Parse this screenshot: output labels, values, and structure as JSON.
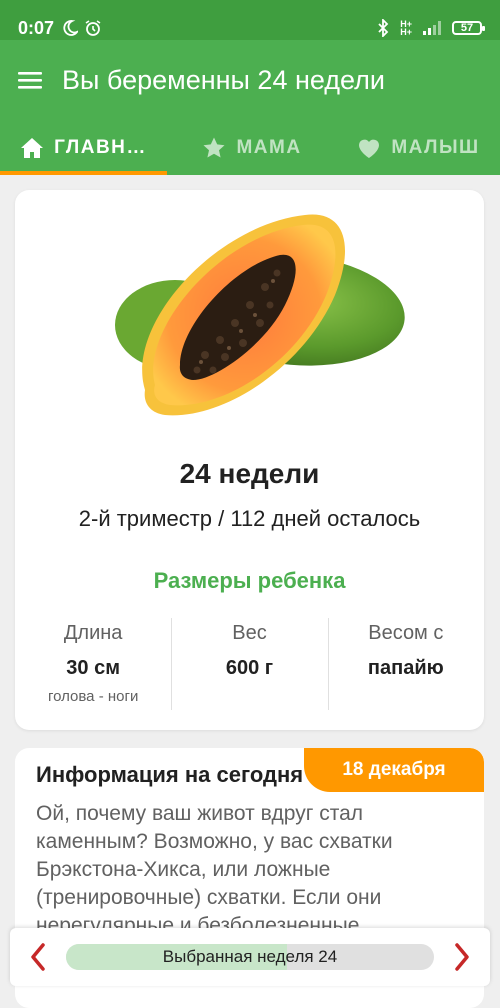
{
  "status_bar": {
    "time": "0:07",
    "battery": "57",
    "network_top": "H+",
    "network_bottom": "H+"
  },
  "app_bar": {
    "title": "Вы беременны 24 недели"
  },
  "tabs": [
    {
      "label": "ГЛАВН…",
      "icon": "home-icon",
      "active": true
    },
    {
      "label": "МАМА",
      "icon": "star-icon",
      "active": false
    },
    {
      "label": "МАЛЫШ",
      "icon": "heart-icon",
      "active": false
    }
  ],
  "week_card": {
    "image": "papaya-image",
    "week_title": "24 недели",
    "subtitle": "2-й триместр / 112 дней осталось",
    "sizes_title": "Размеры ребенка",
    "stats": [
      {
        "label": "Длина",
        "value": "30 см",
        "sub": "голова - ноги"
      },
      {
        "label": "Вес",
        "value": "600 г",
        "sub": ""
      },
      {
        "label": "Весом с",
        "value": "папайю",
        "sub": ""
      }
    ]
  },
  "info_card": {
    "title": "Информация на сегодня",
    "date": "18 декабря",
    "text": "Ой, почему ваш живот вдруг стал каменным? Возможно, у вас схватки Брэкстона-Хикса, или ложные (тренировочные) схватки. Если они нерегулярные и безболезненные,"
  },
  "week_selector": {
    "label": "Выбранная неделя 24",
    "progress": 0.6
  },
  "colors": {
    "status_bar": "#3f9e3f",
    "primary": "#4caf50",
    "accent": "#ff9800",
    "nav_arrow": "#c62828"
  }
}
